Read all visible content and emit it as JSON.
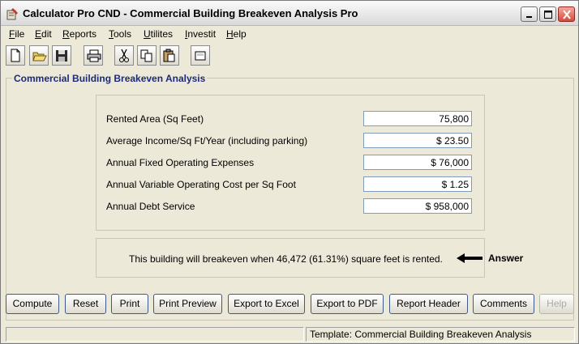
{
  "window": {
    "title": "Calculator Pro CND - Commercial Building Breakeven Analysis Pro"
  },
  "menu": {
    "items": [
      {
        "label": "File",
        "accel": "F",
        "rest": "ile"
      },
      {
        "label": "Edit",
        "accel": "E",
        "rest": "dit"
      },
      {
        "label": "Reports",
        "accel": "R",
        "rest": "eports"
      },
      {
        "label": "Tools",
        "accel": "T",
        "rest": "ools"
      },
      {
        "label": "Utilites",
        "accel": "U",
        "rest": "tilites"
      },
      {
        "label": "Investit",
        "accel": "I",
        "rest": "nvestit"
      },
      {
        "label": "Help",
        "accel": "H",
        "rest": "elp"
      }
    ]
  },
  "toolbar": {
    "icons": [
      "new-file-icon",
      "open-folder-icon",
      "save-icon",
      "print-icon",
      "cut-icon",
      "copy-icon",
      "paste-icon",
      "calculator-icon"
    ]
  },
  "group": {
    "title": "Commercial Building Breakeven Analysis"
  },
  "fields": [
    {
      "label": "Rented Area (Sq Feet)",
      "value": "75,800"
    },
    {
      "label": "Average Income/Sq Ft/Year (including parking)",
      "value": "$ 23.50"
    },
    {
      "label": "Annual Fixed Operating Expenses",
      "value": "$ 76,000"
    },
    {
      "label": "Annual Variable Operating Cost per Sq Foot",
      "value": "$ 1.25"
    },
    {
      "label": "Annual Debt Service",
      "value": "$ 958,000"
    }
  ],
  "result": {
    "text": "This building will breakeven when 46,472 (61.31%) square feet is rented.",
    "answer_label": "Answer"
  },
  "buttons": [
    {
      "label": "Compute",
      "enabled": true
    },
    {
      "label": "Reset",
      "enabled": true
    },
    {
      "label": "Print",
      "enabled": true
    },
    {
      "label": "Print Preview",
      "enabled": true
    },
    {
      "label": "Export to Excel",
      "enabled": true
    },
    {
      "label": "Export to PDF",
      "enabled": true
    },
    {
      "label": "Report Header",
      "enabled": true
    },
    {
      "label": "Comments",
      "enabled": true
    },
    {
      "label": "Help",
      "enabled": false
    }
  ],
  "status": {
    "left": "",
    "right": "Template: Commercial Building Breakeven Analysis"
  },
  "colors": {
    "group_title": "#1c2a7a",
    "window_bg": "#ece9d8",
    "close_button": "#d44b3b"
  }
}
